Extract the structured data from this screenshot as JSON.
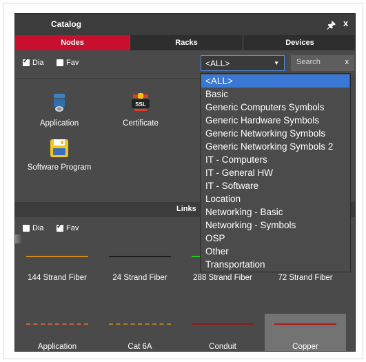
{
  "window": {
    "title": "Catalog",
    "pin_icon": "pin-icon",
    "close_label": "x"
  },
  "tabs": [
    {
      "label": "Nodes",
      "active": true
    },
    {
      "label": "Racks",
      "active": false
    },
    {
      "label": "Devices",
      "active": false
    }
  ],
  "filters": {
    "dia_label": "Dia",
    "dia_checked": true,
    "fav_label": "Fav",
    "fav_checked": false,
    "select_value": "<ALL>",
    "search_placeholder": "Search",
    "search_clear": "x"
  },
  "nodes": [
    {
      "label": "Application",
      "icon": "application-icon"
    },
    {
      "label": "Certificate",
      "icon": "certificate-icon"
    },
    {
      "label": "Software Program",
      "icon": "software-program-icon"
    }
  ],
  "links_section": {
    "title": "Links",
    "dia_label": "Dia",
    "dia_checked": false,
    "fav_label": "Fav",
    "fav_checked": true
  },
  "links": [
    {
      "label": "144 Strand Fiber",
      "color": "#d08a1a",
      "style": "solid"
    },
    {
      "label": "24 Strand Fiber",
      "color": "#1e1e1e",
      "style": "solid"
    },
    {
      "label": "288 Strand Fiber",
      "color": "#22cc22",
      "style": "solid"
    },
    {
      "label": "72 Strand Fiber",
      "color": "#1e1e1e",
      "style": "solid"
    },
    {
      "label": "Application",
      "color": "#c0683a",
      "style": "dashed"
    },
    {
      "label": "Cat 6A",
      "color": "#b07d2a",
      "style": "dashed"
    },
    {
      "label": "Conduit",
      "color": "#8b1a1a",
      "style": "solid"
    },
    {
      "label": "Copper",
      "color": "#b01818",
      "style": "solid",
      "selected": true
    }
  ],
  "dropdown": {
    "options": [
      "<ALL>",
      "Basic",
      "Generic Computers Symbols",
      "Generic Hardware Symbols",
      "Generic Networking Symbols",
      "Generic Networking Symbols 2",
      "IT - Computers",
      "IT - General HW",
      "IT - Software",
      "Location",
      "Networking - Basic",
      "Networking - Symbols",
      "OSP",
      "Other",
      "Transportation"
    ],
    "selected_index": 0
  },
  "colors": {
    "accent_red": "#c8102e",
    "selection_blue": "#3a78d6",
    "panel_bg": "#4a4a4a"
  }
}
